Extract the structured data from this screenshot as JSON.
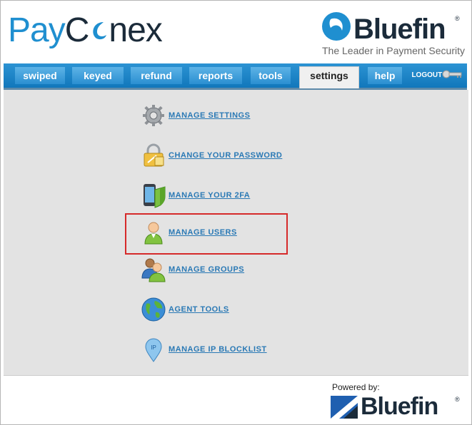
{
  "brand": {
    "paycon_part1": "Pay",
    "paycon_part2": "C",
    "paycon_part3": "nex",
    "bluefin": "Bluefin",
    "registered": "®",
    "tagline": "The Leader in Payment Security",
    "colors": {
      "blue": "#1f8fd0",
      "navy": "#1b2b3a"
    }
  },
  "nav": {
    "tabs": [
      {
        "label": "swiped"
      },
      {
        "label": "keyed"
      },
      {
        "label": "refund"
      },
      {
        "label": "reports"
      },
      {
        "label": "tools"
      },
      {
        "label": "settings",
        "active": true
      },
      {
        "label": "help"
      }
    ],
    "logout": "LOGOUT"
  },
  "menu": [
    {
      "label": "MANAGE SETTINGS",
      "icon": "gear-icon"
    },
    {
      "label": "CHANGE YOUR PASSWORD",
      "icon": "lock-icon"
    },
    {
      "label": "MANAGE YOUR 2FA",
      "icon": "phone-shield-icon"
    },
    {
      "label": "MANAGE USERS",
      "icon": "user-icon"
    },
    {
      "label": "MANAGE GROUPS",
      "icon": "users-icon"
    },
    {
      "label": "AGENT TOOLS",
      "icon": "globe-icon"
    },
    {
      "label": "MANAGE IP BLOCKLIST",
      "icon": "ip-pin-icon"
    }
  ],
  "footer": {
    "powered_by": "Powered by:",
    "bluefin": "Bluefin",
    "registered": "®"
  }
}
